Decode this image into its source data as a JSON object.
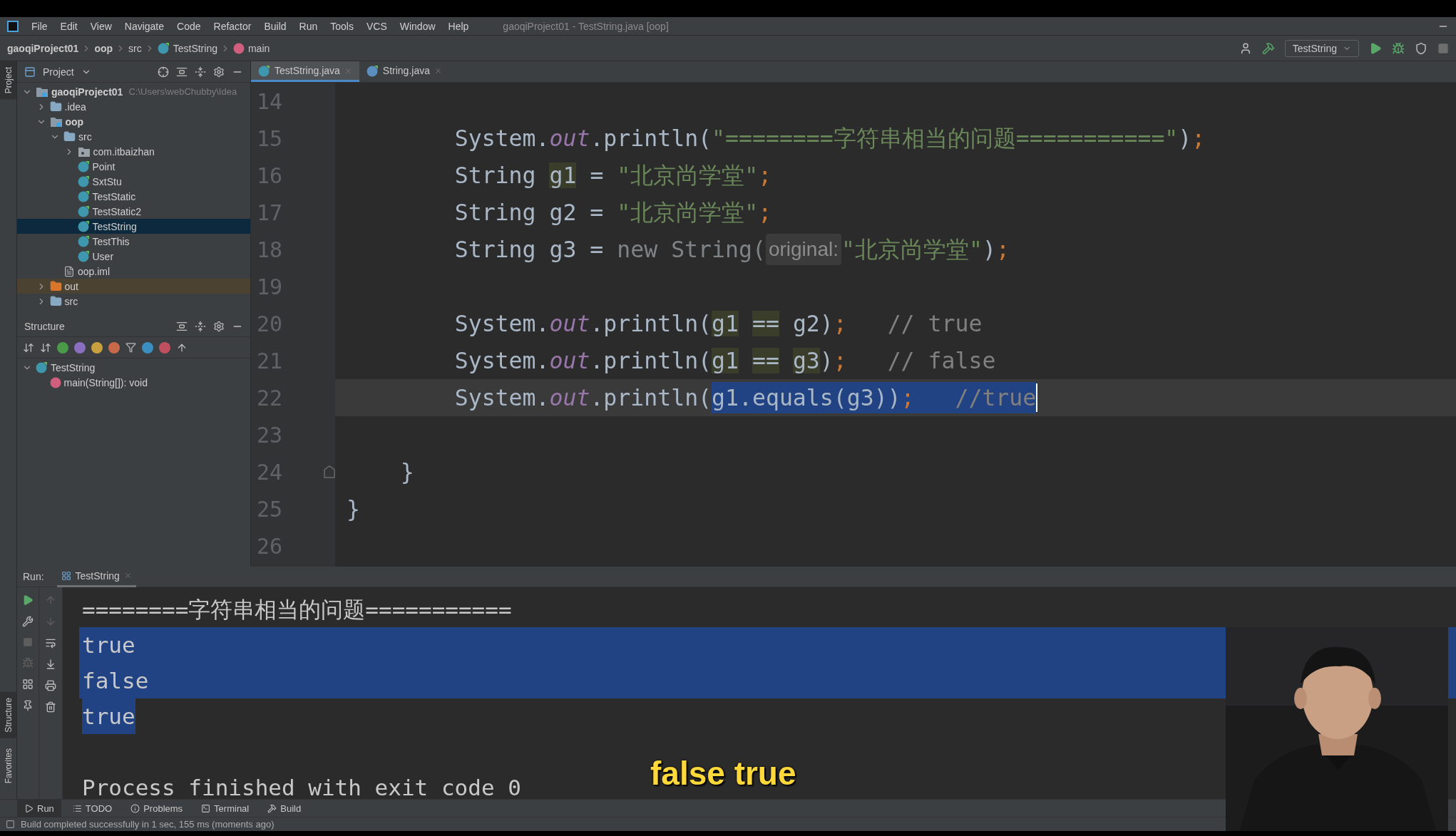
{
  "menu": {
    "items": [
      "File",
      "Edit",
      "View",
      "Navigate",
      "Code",
      "Refactor",
      "Build",
      "Run",
      "Tools",
      "VCS",
      "Window",
      "Help"
    ],
    "title": "gaoqiProject01 - TestString.java [oop]"
  },
  "breadcrumbs": [
    {
      "label": "gaoqiProject01",
      "kind": "module"
    },
    {
      "label": "oop",
      "kind": "module"
    },
    {
      "label": "src",
      "kind": "folder"
    },
    {
      "label": "TestString",
      "kind": "class"
    },
    {
      "label": "main",
      "kind": "method"
    }
  ],
  "toolbar": {
    "run_config": "TestString"
  },
  "side_tabs": {
    "top": [
      {
        "label": "Project",
        "selected": true
      }
    ],
    "bottom": [
      {
        "label": "Structure",
        "selected": true
      },
      {
        "label": "Favorites",
        "selected": false
      }
    ]
  },
  "project": {
    "title": "Project",
    "tree": [
      {
        "label": "gaoqiProject01",
        "path": "C:\\Users\\webChubby\\Idea",
        "kind": "module",
        "expanded": true,
        "selected": false,
        "children": [
          {
            "label": ".idea",
            "kind": "folder",
            "expanded": false,
            "selected": false
          },
          {
            "label": "oop",
            "kind": "module",
            "expanded": true,
            "selected": false,
            "children": [
              {
                "label": "src",
                "kind": "folder",
                "expanded": true,
                "selected": false,
                "children": [
                  {
                    "label": "com.itbaizhan",
                    "kind": "package",
                    "expanded": false,
                    "selected": false
                  },
                  {
                    "label": "Point",
                    "kind": "class",
                    "selected": false
                  },
                  {
                    "label": "SxtStu",
                    "kind": "class",
                    "selected": false
                  },
                  {
                    "label": "TestStatic",
                    "kind": "class",
                    "selected": false
                  },
                  {
                    "label": "TestStatic2",
                    "kind": "class",
                    "selected": false
                  },
                  {
                    "label": "TestString",
                    "kind": "class",
                    "selected": true
                  },
                  {
                    "label": "TestThis",
                    "kind": "class",
                    "selected": false
                  },
                  {
                    "label": "User",
                    "kind": "class",
                    "selected": false
                  }
                ]
              },
              {
                "label": "oop.iml",
                "kind": "file",
                "selected": false
              }
            ]
          },
          {
            "label": "out",
            "kind": "excluded",
            "expanded": false,
            "selected": false
          },
          {
            "label": "src",
            "kind": "folder",
            "expanded": false,
            "selected": false
          }
        ]
      }
    ]
  },
  "structure": {
    "title": "Structure",
    "tree": [
      {
        "label": "TestString",
        "kind": "class",
        "expanded": true,
        "selected": false,
        "children": [
          {
            "label": "main(String[]): void",
            "kind": "method",
            "selected": false
          }
        ]
      }
    ]
  },
  "editor": {
    "tabs": [
      {
        "label": "TestString.java",
        "kind": "class",
        "selected": true
      },
      {
        "label": "String.java",
        "kind": "library",
        "selected": false
      }
    ],
    "lines": [
      {
        "number": "14",
        "current": false
      },
      {
        "number": "15",
        "current": false,
        "segments": [
          {
            "text": "        System.",
            "kind": "plain"
          },
          {
            "text": "out",
            "kind": "field"
          },
          {
            "text": ".println(",
            "kind": "plain"
          },
          {
            "text": "\"========字符串相当的问题===========\"",
            "kind": "string"
          },
          {
            "text": ")",
            "kind": "plain"
          },
          {
            "text": ";",
            "kind": "semi"
          }
        ]
      },
      {
        "number": "16",
        "current": false,
        "segments": [
          {
            "text": "        String ",
            "kind": "plain"
          },
          {
            "text": "g1",
            "kind": "usage"
          },
          {
            "text": " = ",
            "kind": "plain"
          },
          {
            "text": "\"北京尚学堂\"",
            "kind": "string"
          },
          {
            "text": ";",
            "kind": "semi"
          }
        ]
      },
      {
        "number": "17",
        "current": false,
        "segments": [
          {
            "text": "        String g2 = ",
            "kind": "plain"
          },
          {
            "text": "\"北京尚学堂\"",
            "kind": "string"
          },
          {
            "text": ";",
            "kind": "semi"
          }
        ]
      },
      {
        "number": "18",
        "current": false,
        "segments": [
          {
            "text": "        String g3 = ",
            "kind": "plain"
          },
          {
            "text": "new String(",
            "kind": "dim"
          },
          {
            "text": "original:",
            "kind": "hint"
          },
          {
            "text": "\"北京尚学堂\"",
            "kind": "string"
          },
          {
            "text": ")",
            "kind": "plain"
          },
          {
            "text": ";",
            "kind": "semi"
          }
        ]
      },
      {
        "number": "19",
        "current": false
      },
      {
        "number": "20",
        "current": false,
        "segments": [
          {
            "text": "        System.",
            "kind": "plain"
          },
          {
            "text": "out",
            "kind": "field"
          },
          {
            "text": ".println(",
            "kind": "plain"
          },
          {
            "text": "g1",
            "kind": "usage"
          },
          {
            "text": " ==",
            "kind": "usage"
          },
          {
            "text": " g2)",
            "kind": "plain"
          },
          {
            "text": ";",
            "kind": "semi"
          },
          {
            "text": "   // true",
            "kind": "comment"
          }
        ]
      },
      {
        "number": "21",
        "current": false,
        "segments": [
          {
            "text": "        System.",
            "kind": "plain"
          },
          {
            "text": "out",
            "kind": "field"
          },
          {
            "text": ".println(",
            "kind": "plain"
          },
          {
            "text": "g1",
            "kind": "usage"
          },
          {
            "text": " ==",
            "kind": "usage"
          },
          {
            "text": " g3",
            "kind": "usage"
          },
          {
            "text": ")",
            "kind": "plain"
          },
          {
            "text": ";",
            "kind": "semi"
          },
          {
            "text": "   // false",
            "kind": "comment"
          }
        ]
      },
      {
        "number": "22",
        "current": true,
        "caret": true,
        "segments": [
          {
            "text": "        System.",
            "kind": "plain",
            "selected": false
          },
          {
            "text": "out",
            "kind": "field",
            "selected": false
          },
          {
            "text": ".println(",
            "kind": "plain",
            "selected": false
          },
          {
            "text": "g1.equals(g3))",
            "kind": "plain",
            "selected": true
          },
          {
            "text": ";",
            "kind": "semi",
            "selected": true
          },
          {
            "text": "   //true",
            "kind": "comment",
            "selected": true
          }
        ]
      },
      {
        "number": "23",
        "current": false
      },
      {
        "number": "24",
        "current": false,
        "fold_marker": true,
        "segments": [
          {
            "text": "    }",
            "kind": "plain"
          }
        ]
      },
      {
        "number": "25",
        "current": false,
        "segments": [
          {
            "text": "}",
            "kind": "plain"
          }
        ]
      },
      {
        "number": "26",
        "current": false
      }
    ]
  },
  "run": {
    "label": "Run:",
    "tab": "TestString",
    "console": [
      {
        "text": "========字符串相当的问题===========",
        "kind": "output",
        "selected": false
      },
      {
        "text": "true",
        "kind": "output",
        "selected": true
      },
      {
        "text": "false",
        "kind": "output",
        "selected": true
      },
      {
        "text": "true",
        "kind": "output",
        "selected": true
      },
      {
        "text": "Process finished with exit code 0",
        "kind": "exit",
        "selected": false
      }
    ]
  },
  "bottom_tools": [
    {
      "label": "Run",
      "kind": "run",
      "selected": true
    },
    {
      "label": "TODO",
      "kind": "todo",
      "selected": false
    },
    {
      "label": "Problems",
      "kind": "problems",
      "selected": false
    },
    {
      "label": "Terminal",
      "kind": "terminal",
      "selected": false
    },
    {
      "label": "Build",
      "kind": "build",
      "selected": false
    }
  ],
  "status": "Build completed successfully in 1 sec, 155 ms (moments ago)",
  "video": {
    "kind": "picture",
    "subtitle": "false true"
  }
}
